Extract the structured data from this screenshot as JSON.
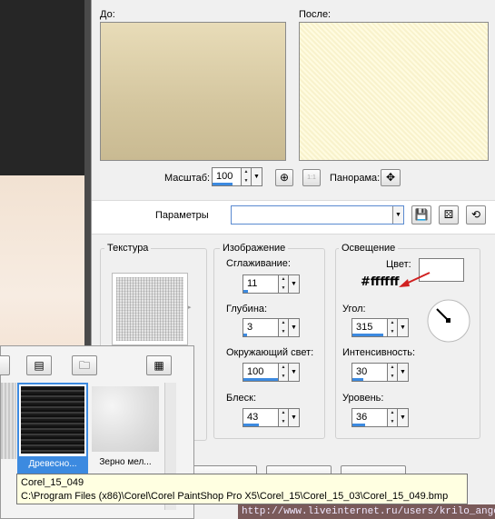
{
  "preview": {
    "before_label": "До:",
    "after_label": "После:"
  },
  "toolbar": {
    "zoom_label": "Масштаб:",
    "zoom_value": "100",
    "zoom_progress": 0.67,
    "pan_label": "Панорама:",
    "one_to_one": "1:1"
  },
  "params": {
    "label": "Параметры",
    "value": ""
  },
  "texture": {
    "title": "Текстура"
  },
  "image_group": {
    "title": "Изображение",
    "smoothing": {
      "label": "Сглаживание:",
      "value": "11",
      "progress": 0.11
    },
    "depth": {
      "label": "Глубина:",
      "value": "3",
      "progress": 0.1
    },
    "ambient": {
      "label": "Окружающий свет:",
      "value": "100",
      "progress": 1.0
    },
    "shine": {
      "label": "Блеск:",
      "value": "43",
      "progress": 0.43
    }
  },
  "light_group": {
    "title": "Освещение",
    "color_label": "Цвет:",
    "color_value": "#ffffff",
    "color_hex_text": "#ffffff",
    "angle": {
      "label": "Угол:",
      "value": "315",
      "progress": 0.875
    },
    "intensity": {
      "label": "Интенсивность:",
      "value": "30",
      "progress": 0.3
    },
    "level": {
      "label": "Уровень:",
      "value": "36",
      "progress": 0.36
    }
  },
  "popup": {
    "items": [
      {
        "label": "",
        "selected": false
      },
      {
        "label": "Древесно...",
        "selected": true
      },
      {
        "label": "Зерно мел...",
        "selected": false
      }
    ]
  },
  "tooltip": {
    "name": "Corel_15_049",
    "path": "C:\\Program Files (x86)\\Corel\\Corel PaintShop Pro X5\\Corel_15\\Corel_15_03\\Corel_15_049.bmp"
  },
  "watermark": {
    "url": "http://www.liveinternet.ru/users/krilo_angela/"
  },
  "colors": {
    "accent": "#3c8ae0",
    "before": "#d6c9a2",
    "after": "#fdf9d6",
    "arrow": "#d02020"
  }
}
